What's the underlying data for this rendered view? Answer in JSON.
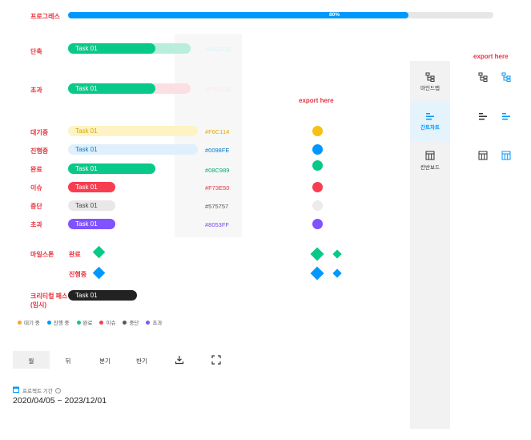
{
  "colors": {
    "accent": "#0098FE",
    "red": "#E8343F",
    "success": "#08C989",
    "waiting": "#F6C114",
    "in_progress": "#0098FE",
    "done": "#08C989",
    "issue": "#F73E50",
    "stopped": "#575757",
    "over": "#8053FF"
  },
  "progress": {
    "label": "프로그레스",
    "value": 0.8,
    "value_text": "80%"
  },
  "rows": {
    "short": {
      "label": "단축",
      "task": "Task 01",
      "hex": "#08CFDC"
    },
    "over_time": {
      "label": "초과",
      "task": "Task 01",
      "hex": "#F5D6D9"
    },
    "waiting": {
      "label": "대기중",
      "task": "Task 01",
      "hex": "#F6C114"
    },
    "in_progress": {
      "label": "진행중",
      "task": "Task 01",
      "hex": "#0098FE"
    },
    "done": {
      "label": "완료",
      "task": "Task 01",
      "hex": "#08C989"
    },
    "issue": {
      "label": "이슈",
      "task": "Task 01",
      "hex": "#F73E50"
    },
    "stopped": {
      "label": "중단",
      "task": "Task 01",
      "hex": "#575757"
    },
    "over": {
      "label": "초과",
      "task": "Task 01",
      "hex": "#8053FF"
    }
  },
  "export_here_1": "export here",
  "export_here_2": "export here",
  "milestone": {
    "label": "마일스톤",
    "done_label": "완료",
    "in_progress_label": "진행중"
  },
  "critical_path": {
    "label": "크리티컬 패스",
    "sublabel": "(임시)",
    "task": "Task 01"
  },
  "legend": [
    {
      "label": "대기 중",
      "color": "#F6A623"
    },
    {
      "label": "진행 중",
      "color": "#0098FE"
    },
    {
      "label": "완료",
      "color": "#08C989"
    },
    {
      "label": "이슈",
      "color": "#F73E50"
    },
    {
      "label": "중단",
      "color": "#575757"
    },
    {
      "label": "초과",
      "color": "#8053FF"
    }
  ],
  "toolbar": {
    "month": "월",
    "week": "뒤",
    "quarter": "분기",
    "half": "반기",
    "download_icon": "download-icon",
    "fullscreen_icon": "fullscreen-icon"
  },
  "project_period": {
    "label": "프로젝트 기간",
    "value": "2020/04/05 ~ 2023/12/01"
  },
  "side_panel": {
    "mindmap": "마인드맵",
    "gantt": "간트차트",
    "kanban": "칸반보드"
  }
}
